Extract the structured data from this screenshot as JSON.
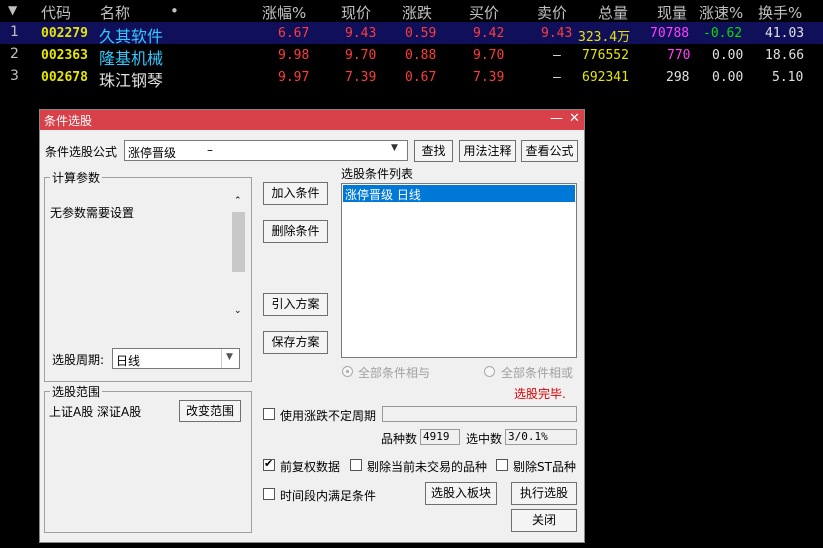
{
  "table": {
    "headers": {
      "arrow": "▼",
      "code": "代码",
      "name": "名称",
      "dot": "•",
      "pct": "涨幅%",
      "price": "现价",
      "change": "涨跌",
      "bid": "买价",
      "ask": "卖价",
      "volume": "总量",
      "cur_vol": "现量",
      "speed": "涨速%",
      "turnover": "换手%"
    },
    "rows": [
      {
        "idx": "1",
        "code": "002279",
        "name": "久其软件",
        "pct": "6.67",
        "price": "9.43",
        "change": "0.59",
        "bid": "9.42",
        "ask": "9.43",
        "volume": "323.4万",
        "cur_vol": "70788",
        "speed": "-0.62",
        "turnover": "41.03"
      },
      {
        "idx": "2",
        "code": "002363",
        "name": "隆基机械",
        "pct": "9.98",
        "price": "9.70",
        "change": "0.88",
        "bid": "9.70",
        "ask": "—",
        "volume": "776552",
        "cur_vol": "770",
        "speed": "0.00",
        "turnover": "18.66"
      },
      {
        "idx": "3",
        "code": "002678",
        "name": "珠江钢琴",
        "pct": "9.97",
        "price": "7.39",
        "change": "0.67",
        "bid": "7.39",
        "ask": "—",
        "volume": "692341",
        "cur_vol": "298",
        "speed": "0.00",
        "turnover": "5.10"
      }
    ]
  },
  "dialog": {
    "title": "条件选股",
    "minimize": "—",
    "close": "✕",
    "formula_label": "条件选股公式",
    "formula_value": "涨停晋级",
    "formula_dash": "–",
    "find_btn": "查找",
    "usage_btn": "用法注释",
    "view_btn": "查看公式",
    "params_group": "计算参数",
    "params_text": "无参数需要设置",
    "period_label": "选股周期:",
    "period_value": "日线",
    "range_group": "选股范围",
    "range_text": "上证A股 深证A股",
    "change_range_btn": "改变范围",
    "add_cond_btn": "加入条件",
    "del_cond_btn": "删除条件",
    "import_btn": "引入方案",
    "save_btn": "保存方案",
    "cond_list_label": "选股条件列表",
    "cond_items": [
      "涨停晋级  日线"
    ],
    "radio_and": "全部条件相与",
    "radio_or": "全部条件相或",
    "status": "选股完毕.",
    "uncertain_label": "使用涨跌不定周期",
    "count_label": "品种数",
    "count_value": "4919",
    "selected_label": "选中数",
    "selected_value": "3/0.1%",
    "prefq_label": "前复权数据",
    "exclude_notrade_label": "剔除当前未交易的品种",
    "exclude_st_label": "剔除ST品种",
    "timerange_label": "时间段内满足条件",
    "to_block_btn": "选股入板块",
    "run_btn": "执行选股",
    "close_btn": "关闭",
    "prefq_checked": "✔"
  },
  "colors": {
    "title_bar": "#d8404a",
    "selected_item": "#0078d7",
    "status_red": "#e00000",
    "up_red": "#ff3c3c"
  }
}
